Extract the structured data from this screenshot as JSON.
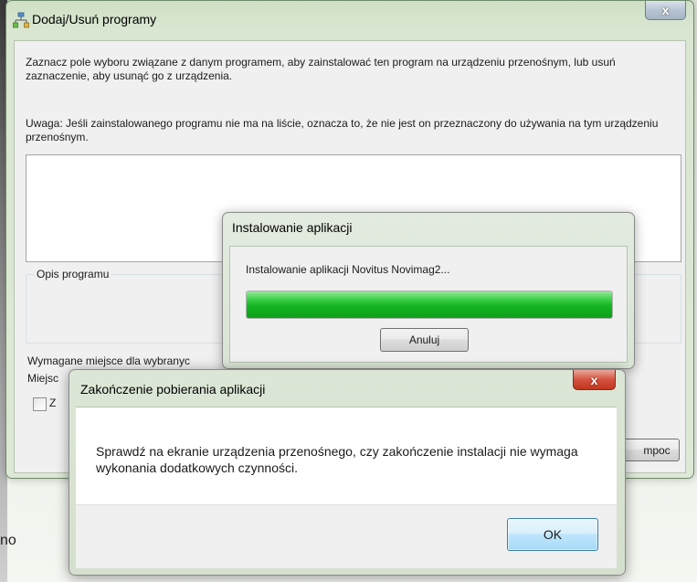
{
  "main_window": {
    "title": "Dodaj/Usuń programy",
    "close_glyph": "x",
    "intro_text": "Zaznacz pole wyboru związane z danym programem, aby zainstalować ten program na urządzeniu przenośnym, lub usuń zaznaczenie, aby usunąć go z urządzenia.",
    "note_text": "Uwaga: Jeśli zainstalowanego programu nie ma na liście, oznacza to, że nie jest on przeznaczony do używania na tym urządzeniu przenośnym.",
    "program_description_label": "Opis programu",
    "required_space_label": "Wymagane miejsce dla wybranyc",
    "available_space_label": "Miejsc",
    "checkbox_label": "Z",
    "help_button_label": "mpoc"
  },
  "install_dialog": {
    "title": "Instalowanie aplikacji",
    "status_text": "Instalowanie aplikacji Novitus Novimag2...",
    "progress": 1.0,
    "cancel_label": "Anuluj"
  },
  "finish_dialog": {
    "title": "Zakończenie pobierania aplikacji",
    "close_glyph": "x",
    "message": "Sprawdź na ekranie urządzenia przenośnego, czy zakończenie instalacji nie wymaga wykonania dodatkowych czynności.",
    "ok_label": "OK"
  },
  "background": {
    "partial_text": "no"
  },
  "icons": {
    "app_icon": "programs-icon",
    "close_icon": "close-icon"
  },
  "colors": {
    "progress_green": "#13b521",
    "close_red": "#c2351f",
    "ok_blue": "#3c7fb1"
  }
}
